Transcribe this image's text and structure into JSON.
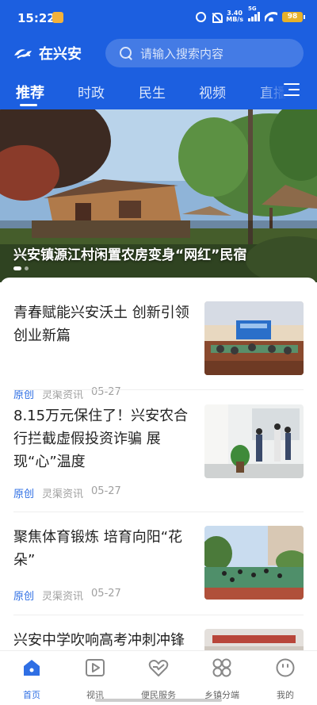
{
  "status_bar": {
    "time": "15:22",
    "net_speed": "3.40",
    "net_unit": "MB/s",
    "signal_label": "5G",
    "battery": "98"
  },
  "header": {
    "app_name": "在兴安",
    "search_placeholder": "请输入搜索内容"
  },
  "tabs": [
    {
      "label": "推荐",
      "active": true
    },
    {
      "label": "时政",
      "active": false
    },
    {
      "label": "民生",
      "active": false
    },
    {
      "label": "视频",
      "active": false
    },
    {
      "label": "直播",
      "active": false
    }
  ],
  "banner": {
    "title": "兴安镇源江村闲置农房变身“网红”民宿",
    "slide_index": 1,
    "slide_count": 2
  },
  "feed": [
    {
      "title": "青春赋能兴安沃土 创新引领创业新篇",
      "tag": "原创",
      "source": "灵渠资讯",
      "date": "05-27"
    },
    {
      "title": "8.15万元保住了！兴安农合行拦截虚假投资诈骗 展现“心”温度",
      "tag": "原创",
      "source": "灵渠资讯",
      "date": "05-27"
    },
    {
      "title": "聚焦体育锻炼 培育向阳“花朵”",
      "tag": "原创",
      "source": "灵渠资讯",
      "date": "05-27"
    },
    {
      "title": "兴安中学吹响高考冲刺冲锋"
    }
  ],
  "bottom_nav": [
    {
      "label": "首页",
      "icon": "home-icon",
      "active": true
    },
    {
      "label": "视讯",
      "icon": "video-play-icon",
      "active": false
    },
    {
      "label": "便民服务",
      "icon": "heart-service-icon",
      "active": false
    },
    {
      "label": "乡镇分端",
      "icon": "grid-clover-icon",
      "active": false
    },
    {
      "label": "我的",
      "icon": "smiley-face-icon",
      "active": false
    }
  ],
  "colors": {
    "brand_blue": "#1c5fe0",
    "accent_blue": "#2f6fe4",
    "meta_gray": "#a0a0a0"
  }
}
